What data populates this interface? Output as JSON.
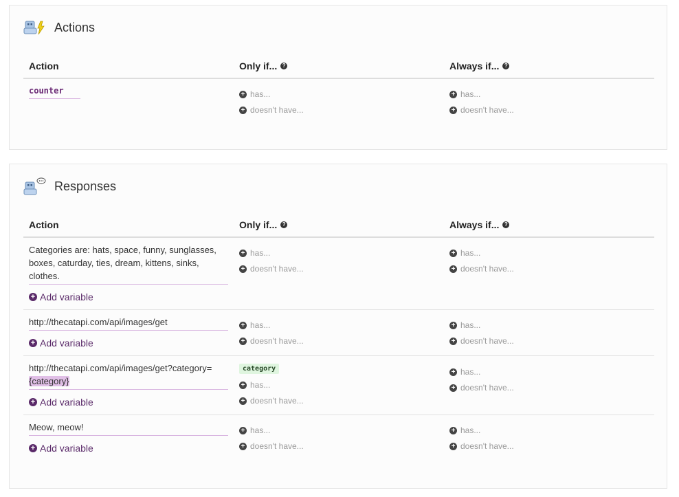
{
  "actions": {
    "title": "Actions",
    "columns": {
      "action": "Action",
      "only_if": "Only if...",
      "always_if": "Always if..."
    },
    "help_glyph": "?",
    "rows": [
      {
        "name": "counter",
        "only": {
          "has": "has...",
          "doesnt": "doesn't have..."
        },
        "always": {
          "has": "has...",
          "doesnt": "doesn't have..."
        }
      }
    ]
  },
  "responses": {
    "title": "Responses",
    "columns": {
      "action": "Action",
      "only_if": "Only if...",
      "always_if": "Always if..."
    },
    "add_variable_label": "Add variable",
    "rows": [
      {
        "text": "Categories are: hats, space, funny, sunglasses, boxes, caturday, ties, dream, kittens, sinks, clothes.",
        "only": {
          "has": "has...",
          "doesnt": "doesn't have..."
        },
        "always": {
          "has": "has...",
          "doesnt": "doesn't have..."
        }
      },
      {
        "text": "http://thecatapi.com/api/images/get",
        "only": {
          "has": "has...",
          "doesnt": "doesn't have..."
        },
        "always": {
          "has": "has...",
          "doesnt": "doesn't have..."
        }
      },
      {
        "text_prefix": "http://thecatapi.com/api/images/get?category=",
        "variable": "{category}",
        "only_tag": "category",
        "only": {
          "has": "has...",
          "doesnt": "doesn't have..."
        },
        "always": {
          "has": "has...",
          "doesnt": "doesn't have..."
        }
      },
      {
        "text": "Meow, meow!",
        "only": {
          "has": "has...",
          "doesnt": "doesn't have..."
        },
        "always": {
          "has": "has...",
          "doesnt": "doesn't have..."
        }
      }
    ]
  },
  "icons": {
    "plus": "+",
    "robot_actions": "robot-lightning-icon",
    "robot_responses": "robot-speech-icon"
  },
  "colors": {
    "accent": "#5a2a69",
    "underline": "#d8b4e0",
    "tag_bg": "#dff5df"
  }
}
